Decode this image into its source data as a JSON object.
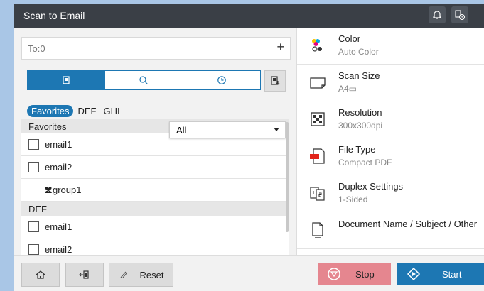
{
  "title": "Scan to Email",
  "to": {
    "label": "To:0",
    "add": "+"
  },
  "tabs": [
    {
      "icon": "address-book-icon"
    },
    {
      "icon": "search-icon"
    },
    {
      "icon": "history-icon"
    }
  ],
  "index": {
    "active": "Favorites",
    "items": [
      "DEF",
      "GHI"
    ]
  },
  "filter": {
    "selected": "All"
  },
  "list": [
    {
      "type": "header",
      "label": "Favorites"
    },
    {
      "type": "item",
      "label": "email1"
    },
    {
      "type": "item",
      "label": "email2"
    },
    {
      "type": "group",
      "label": "group1"
    },
    {
      "type": "header",
      "label": "DEF"
    },
    {
      "type": "item",
      "label": "email1"
    },
    {
      "type": "item",
      "label": "email2"
    }
  ],
  "settings": [
    {
      "title": "Color",
      "value": "Auto Color",
      "icon": "color-icon"
    },
    {
      "title": "Scan Size",
      "value": "A4▭",
      "icon": "paper-size-icon"
    },
    {
      "title": "Resolution",
      "value": "300x300dpi",
      "icon": "resolution-icon"
    },
    {
      "title": "File Type",
      "value": "Compact PDF",
      "icon": "pdf-icon"
    },
    {
      "title": "Duplex Settings",
      "value": "1-Sided",
      "icon": "duplex-icon"
    },
    {
      "title": "Document Name / Subject / Other",
      "value": "",
      "icon": "document-icon"
    }
  ],
  "footer": {
    "reset": "Reset",
    "stop": "Stop",
    "start": "Start"
  },
  "colors": {
    "accent": "#1d77b3",
    "stop": "#e5868f",
    "titlebar": "#3a3f46"
  }
}
